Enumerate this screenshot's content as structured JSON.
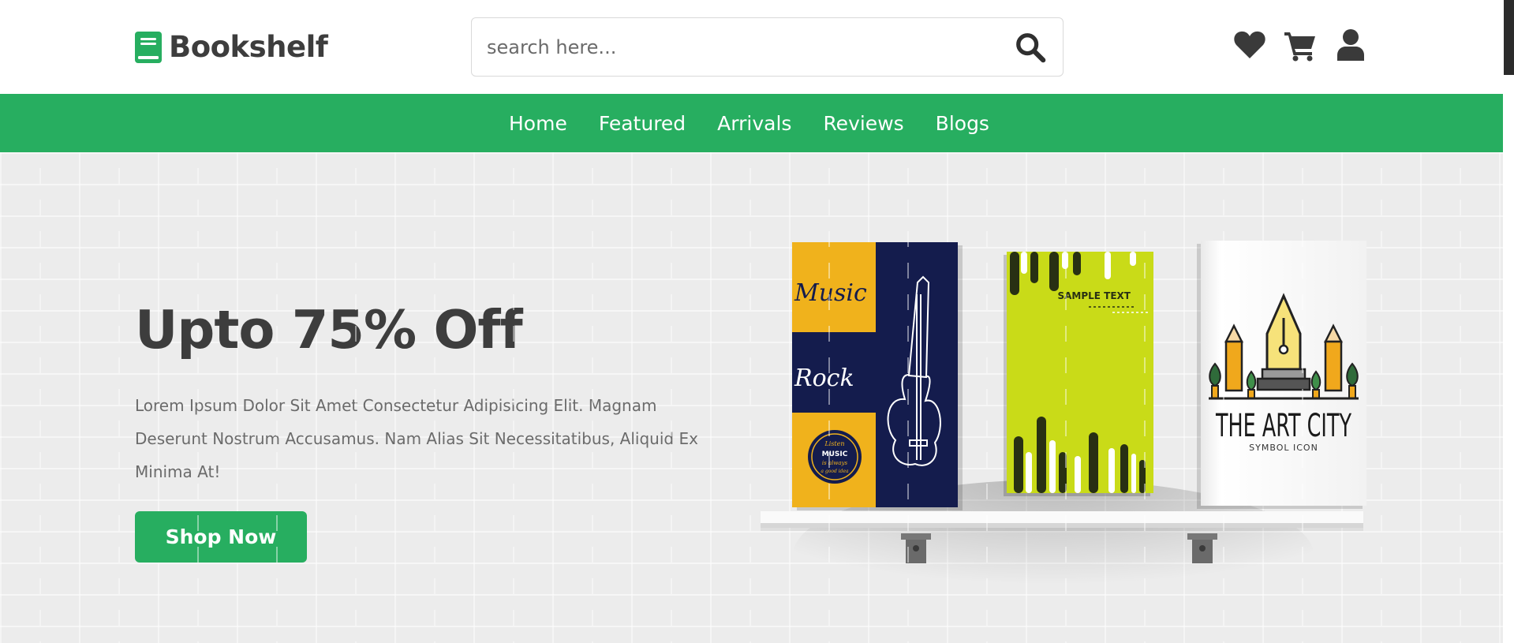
{
  "brand": {
    "name": "Bookshelf"
  },
  "search": {
    "placeholder": "search here..."
  },
  "header_icons": [
    "heart-icon",
    "cart-icon",
    "user-icon"
  ],
  "nav": {
    "items": [
      "Home",
      "Featured",
      "Arrivals",
      "Reviews",
      "Blogs"
    ]
  },
  "hero": {
    "title": "Upto 75% Off",
    "text": "Lorem Ipsum Dolor Sit Amet Consectetur Adipisicing Elit. Magnam Deserunt Nostrum Accusamus. Nam Alias Sit Necessitatibus, Aliquid Ex Minima At!",
    "button": "Shop Now",
    "books": {
      "music": {
        "word1": "Music",
        "word2": "Rock",
        "badge": [
          "Listen",
          "MUSIC",
          "is always",
          "a good idea"
        ]
      },
      "sample": {
        "label": "SAMPLE TEXT"
      },
      "art": {
        "title": "THE ART CITY",
        "subtitle": "SYMBOL ICON"
      }
    }
  },
  "colors": {
    "accent": "#27ae60",
    "text_dark": "#3d3d3d",
    "text_muted": "#6b6b6b",
    "hero_bg": "#ececec"
  }
}
